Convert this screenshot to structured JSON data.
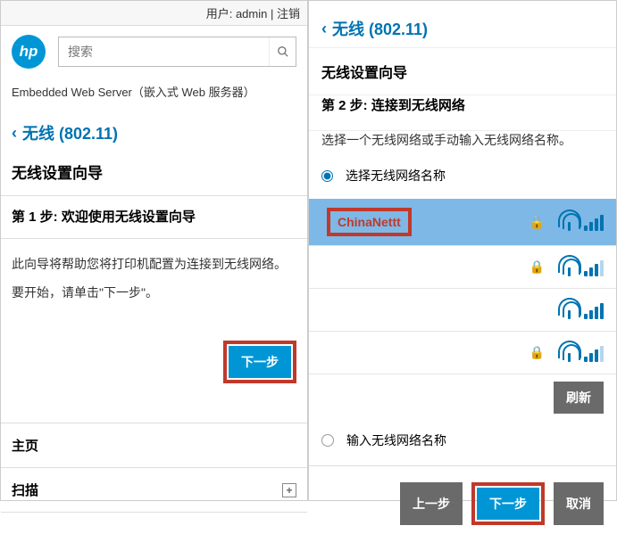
{
  "left": {
    "user_label": "用户: admin",
    "logout": "注销",
    "logo_text": "hp",
    "search_placeholder": "搜索",
    "subtitle": "Embedded Web Server（嵌入式 Web 服务器）",
    "breadcrumb": "无线 (802.11)",
    "heading": "无线设置向导",
    "step": "第 1 步: 欢迎使用无线设置向导",
    "line1": "此向导将帮助您将打印机配置为连接到无线网络。",
    "line2": "要开始，请单击\"下一步\"。",
    "next": "下一步",
    "menu_home": "主页",
    "menu_scan": "扫描"
  },
  "right": {
    "breadcrumb": "无线 (802.11)",
    "heading": "无线设置向导",
    "step": "第 2 步: 连接到无线网络",
    "hint": "选择一个无线网络或手动输入无线网络名称。",
    "opt_select": "选择无线网络名称",
    "opt_manual": "输入无线网络名称",
    "networks": [
      {
        "name": "ChinaNettt",
        "secured": true,
        "strength": 4,
        "selected": true,
        "highlighted": true
      },
      {
        "name": "",
        "secured": true,
        "strength": 3,
        "selected": false,
        "highlighted": false
      },
      {
        "name": "",
        "secured": false,
        "strength": 4,
        "selected": false,
        "highlighted": false
      },
      {
        "name": "",
        "secured": true,
        "strength": 3,
        "selected": false,
        "highlighted": false
      }
    ],
    "refresh": "刷新",
    "prev": "上一步",
    "next": "下一步",
    "cancel": "取消"
  }
}
